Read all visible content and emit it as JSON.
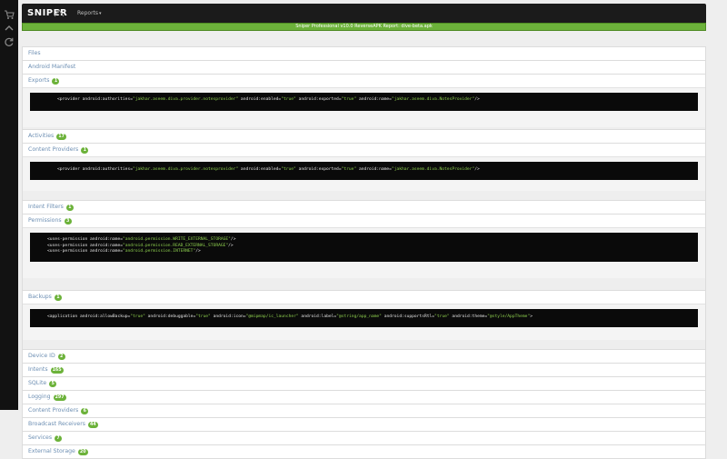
{
  "app": {
    "logo_text": "SNIPER",
    "reports_menu": "Reports",
    "banner": "Sniper Professional v10.0 ReverseAPK Report: dive-beta.apk"
  },
  "sidebar": {
    "icons": [
      "cart-icon",
      "upload-icon",
      "refresh-icon"
    ]
  },
  "sections": {
    "files": {
      "label": "Files"
    },
    "manifest": {
      "label": "Android Manifest"
    },
    "exports": {
      "label": "Exports",
      "badge": "1",
      "code": {
        "pre": "<provider android:authorities=",
        "v1": "\"jakhar.aseem.diva.provider.notesprovider\"",
        "mid1": " android:enabled=",
        "v2": "\"true\"",
        "mid2": " android:exported=",
        "v3": "\"true\"",
        "mid3": " android:name=",
        "v4": "\"jakhar.aseem.diva.NotesProvider\"",
        "post": "/>"
      }
    },
    "activities": {
      "label": "Activities",
      "badge": "17"
    },
    "content_providers": {
      "label": "Content Providers",
      "badge": "1",
      "code": {
        "pre": "<provider android:authorities=",
        "v1": "\"jakhar.aseem.diva.provider.notesprovider\"",
        "mid1": " android:enabled=",
        "v2": "\"true\"",
        "mid2": " android:exported=",
        "v3": "\"true\"",
        "mid3": " android:name=",
        "v4": "\"jakhar.aseem.diva.NotesProvider\"",
        "post": "/>"
      }
    },
    "intent_filters": {
      "label": "Intent Filters",
      "badge": "1"
    },
    "permissions": {
      "label": "Permissions",
      "badge": "3",
      "lines": [
        {
          "pre": "<uses-permission android:name=",
          "val": "\"android.permission.WRITE_EXTERNAL_STORAGE\"",
          "post": "/>"
        },
        {
          "pre": "<uses-permission android:name=",
          "val": "\"android.permission.READ_EXTERNAL_STORAGE\"",
          "post": "/>"
        },
        {
          "pre": "<uses-permission android:name=",
          "val": "\"android.permission.INTERNET\"",
          "post": "/>"
        }
      ]
    },
    "backups": {
      "label": "Backups",
      "badge": "1",
      "code": {
        "pre": "<application android:allowBackup=",
        "v1": "\"true\"",
        "mid1": " android:debuggable=",
        "v2": "\"true\"",
        "mid2": " android:icon=",
        "v3": "\"@mipmap/ic_launcher\"",
        "mid3": " android:label=",
        "v4": "\"@string/app_name\"",
        "mid4": " android:supportsRtl=",
        "v5": "\"true\"",
        "mid5": " android:theme=",
        "v6": "\"@style/AppTheme\"",
        "post": ">"
      }
    },
    "device_id": {
      "label": "Device ID",
      "badge": "2"
    },
    "intents": {
      "label": "Intents",
      "badge": "165"
    },
    "sqlite": {
      "label": "SQLite",
      "badge": "5"
    },
    "logging": {
      "label": "Logging",
      "badge": "297"
    },
    "content_providers_2": {
      "label": "Content Providers",
      "badge": "6"
    },
    "broadcast_receivers": {
      "label": "Broadcast Receivers",
      "badge": "44"
    },
    "services": {
      "label": "Services",
      "badge": "7"
    },
    "external_storage": {
      "label": "External Storage",
      "badge": "20"
    }
  },
  "colors": {
    "accent_green": "#6cb23a",
    "link_blue": "#6d8fb3",
    "code_string": "#8fd14f"
  }
}
